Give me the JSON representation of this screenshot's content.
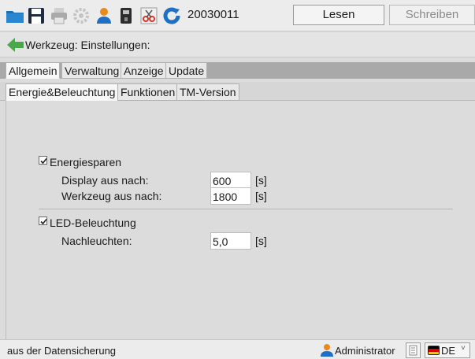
{
  "toolbar": {
    "device_id": "20030011",
    "read_label": "Lesen",
    "write_label": "Schreiben",
    "icons": [
      "folder-icon",
      "save-icon",
      "print-icon",
      "settings-gear-icon",
      "user-icon",
      "device-icon",
      "cut-icon",
      "refresh-icon"
    ]
  },
  "header": {
    "title": "Werkzeug: Einstellungen:",
    "back_icon": "arrow-left-icon"
  },
  "tabs_main": [
    "Allgemein",
    "Verwaltung",
    "Anzeige",
    "Update"
  ],
  "tabs_sub": [
    "Energie&Beleuchtung",
    "Funktionen",
    "TM-Version"
  ],
  "energy": {
    "checkbox_label": "Energiesparen",
    "checked": true,
    "display_label": "Display aus nach:",
    "display_value": "600",
    "display_unit": "[s]",
    "tool_label": "Werkzeug aus nach:",
    "tool_value": "1800",
    "tool_unit": "[s]"
  },
  "led": {
    "checkbox_label": "LED-Beleuchtung",
    "checked": true,
    "afterglow_label": "Nachleuchten:",
    "afterglow_value": "5,0",
    "afterglow_unit": "[s]"
  },
  "status": {
    "text": "aus der Datensicherung",
    "user": "Administrator",
    "language": "DE",
    "lang_arrow": "˅"
  },
  "colors": {
    "accent_green": "#4aa84a",
    "refresh_blue": "#1f6fc4",
    "user_orange": "#e8891c",
    "flag_black": "#000000",
    "flag_red": "#dd0000",
    "flag_gold": "#ffce00"
  }
}
